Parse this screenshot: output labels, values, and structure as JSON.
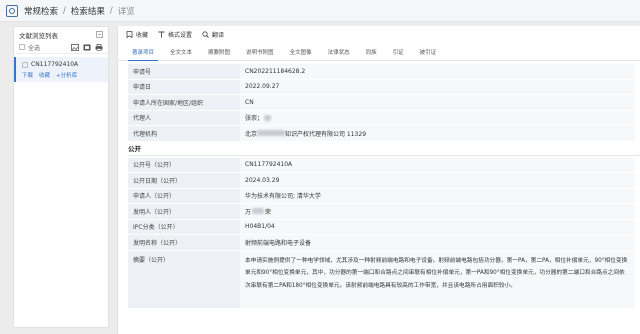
{
  "breadcrumb": {
    "root": "常规检索",
    "middle": "检索结果",
    "current": "详览",
    "sep": "/"
  },
  "sidebar": {
    "title": "文献浏览列表",
    "select_all": "全选",
    "items": [
      {
        "number": "CN117792410A",
        "actions": [
          "下载",
          "收藏",
          "+分析库"
        ]
      }
    ]
  },
  "toolbar": {
    "items": [
      "收藏",
      "格式设置",
      "翻译"
    ]
  },
  "tabs": [
    "著录项目",
    "全文文本",
    "摘要附图",
    "说明书附图",
    "全文图像",
    "法律状态",
    "同族",
    "引证",
    "被引证"
  ],
  "application": [
    {
      "label": "申请号",
      "value": "CN202211184628.2"
    },
    {
      "label": "申请日",
      "value": "2022.09.27"
    },
    {
      "label": "申请人所在国家/地区/组织",
      "value": "CN"
    },
    {
      "label": "代理人",
      "value": "张崇；"
    },
    {
      "label": "代理机构",
      "value_pre": "北京",
      "value_post": "知识产权代理有限公司 11329"
    }
  ],
  "publication_section": "公开",
  "publication": [
    {
      "label": "公开号（公开）",
      "value": "CN117792410A"
    },
    {
      "label": "公开日期（公开）",
      "value": "2024.03.29"
    },
    {
      "label": "申请人（公开）",
      "value": "华为技术有限公司; 清华大学"
    },
    {
      "label": "发明人（公开）",
      "value_pre": "万",
      "value_post": "荣"
    },
    {
      "label": "IPC分类（公开）",
      "value": "H04B1/04"
    },
    {
      "label": "发明名称（公开）",
      "value": "射频前端电路和电子设备"
    }
  ],
  "abstract": {
    "label": "摘要（公开）",
    "text": "本申请实施例提供了一种电学领域，尤其涉及一种射频前端电路和电子设备。射频前端电路包括功分器，第一PA，第二PA，相位补偿单元，90°相位变换单元和90°相位变换单元，其中，功分器的第一端口和合路点之间串联有相位补偿单元，第一PA和90°相位变换单元，功分器的第二端口和合路点之间依次串联有第二PA和180°相位变换单元。该射频前端电路具有较高的工作带宽，并且该电路所占用面积较小。"
  },
  "colors": {
    "accent": "#3b73c8",
    "label_bg": "#edf0f5",
    "value_bg": "#f7f8fa"
  }
}
